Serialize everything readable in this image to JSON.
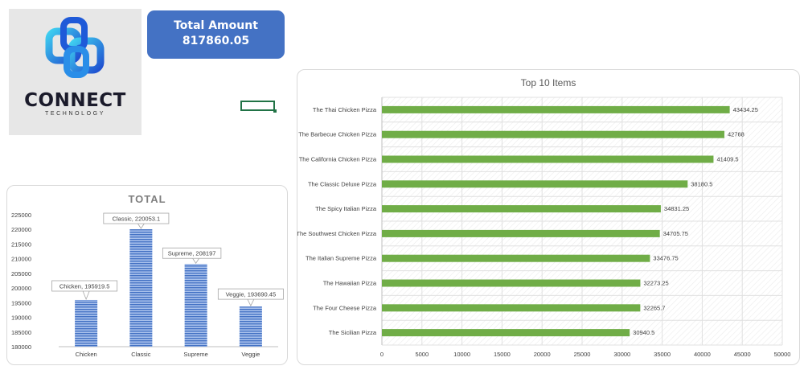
{
  "logo": {
    "word": "CONNECT",
    "sub": "TECHNOLOGY"
  },
  "kpi": {
    "label": "Total Amount",
    "value": "817860.05"
  },
  "colors": {
    "bar_blue": "#4472c4",
    "bar_green": "#70ad47",
    "kpi_bg": "#4472c4"
  },
  "chart_data": [
    {
      "type": "bar",
      "title": "TOTAL",
      "categories": [
        "Chicken",
        "Classic",
        "Supreme",
        "Veggie"
      ],
      "values": [
        195919.5,
        220053.1,
        208197,
        193690.45
      ],
      "data_labels": [
        "Chicken, 195919.5",
        "Classic, 220053.1",
        "Supreme, 208197",
        "Veggie, 193690.45"
      ],
      "ylim": [
        180000,
        225000
      ],
      "yticks": [
        "180000",
        "185000",
        "190000",
        "195000",
        "200000",
        "205000",
        "210000",
        "215000",
        "220000",
        "225000"
      ],
      "grid": false,
      "legend": "none"
    },
    {
      "type": "bar",
      "orientation": "horizontal",
      "title": "Top 10 Items",
      "categories": [
        "The Thai Chicken Pizza",
        "The Barbecue Chicken Pizza",
        "The California Chicken Pizza",
        "The Classic Deluxe Pizza",
        "The Spicy Italian Pizza",
        "The Southwest Chicken Pizza",
        "The Italian Supreme Pizza",
        "The Hawaiian Pizza",
        "The Four Cheese Pizza",
        "The Sicilian Pizza"
      ],
      "values": [
        43434.25,
        42768,
        41409.5,
        38180.5,
        34831.25,
        34705.75,
        33476.75,
        32273.25,
        32265.7,
        30940.5
      ],
      "data_labels": [
        "43434.25",
        "42768",
        "41409.5",
        "38180.5",
        "34831.25",
        "34705.75",
        "33476.75",
        "32273.25",
        "32265.7",
        "30940.5"
      ],
      "xlim": [
        0,
        50000
      ],
      "xticks": [
        "0",
        "5000",
        "10000",
        "15000",
        "20000",
        "25000",
        "30000",
        "35000",
        "40000",
        "45000",
        "50000"
      ],
      "grid": true,
      "legend": "none"
    }
  ]
}
